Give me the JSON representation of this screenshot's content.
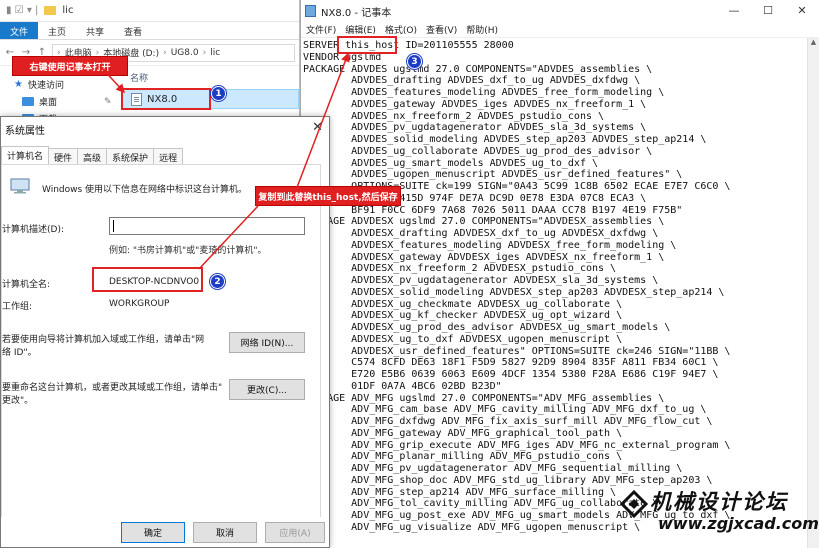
{
  "explorer": {
    "title": "lic",
    "ribbon_tabs": [
      "文件",
      "主页",
      "共享",
      "查看"
    ],
    "breadcrumb": [
      "此电脑",
      "本地磁盘 (D:)",
      "UG8.0",
      "lic"
    ],
    "nav_items": [
      "快速访问",
      "桌面",
      "下载"
    ],
    "column_header": "名称",
    "file_name": "NX8.0"
  },
  "dialog": {
    "title": "系统属性",
    "tabs": [
      "计算机名",
      "硬件",
      "高级",
      "系统保护",
      "远程"
    ],
    "intro": "Windows 使用以下信息在网络中标识这台计算机。",
    "description_label": "计算机描述(D):",
    "description_value": "",
    "example": "例如: \"书房计算机\"或\"麦琦的计算机\"。",
    "fullname_label": "计算机全名:",
    "fullname_value": "DESKTOP-NCDNVO0",
    "workgroup_label": "工作组:",
    "workgroup_value": "WORKGROUP",
    "join_text_1": "若要使用向导将计算机加入域或工作组，请单击\"网",
    "join_text_2": "络 ID\"。",
    "network_id_button": "网络 ID(N)...",
    "rename_text_1": "要重命名这台计算机，或者更改其域或工作组，请单击\"",
    "rename_text_2": "更改\"。",
    "change_button": "更改(C)...",
    "ok_button": "确定",
    "cancel_button": "取消",
    "apply_button": "应用(A)"
  },
  "notepad": {
    "title": "NX8.0 - 记事本",
    "window_controls": [
      "—",
      "☐",
      "✕"
    ],
    "menus": [
      "文件(F)",
      "编辑(E)",
      "格式(O)",
      "查看(V)",
      "帮助(H)"
    ],
    "lines": [
      "SERVER this_host ID=201105555 28000",
      "VENDOR ugslmd",
      "PACKAGE ADVDES ugslmd 27.0 COMPONENTS=\"ADVDES_assemblies \\",
      "        ADVDES_drafting ADVDES_dxf_to_ug ADVDES_dxfdwg \\",
      "        ADVDES_features_modeling ADVDES_free_form_modeling \\",
      "        ADVDES_gateway ADVDES_iges ADVDES_nx_freeform_1 \\",
      "        ADVDES_nx_freeform_2 ADVDES_pstudio_cons \\",
      "        ADVDES_pv_ugdatagenerator ADVDES_sla_3d_systems \\",
      "        ADVDES_solid_modeling ADVDES_step_ap203 ADVDES_step_ap214 \\",
      "        ADVDES_ug_collaborate ADVDES_ug_prod_des_advisor \\",
      "        ADVDES_ug_smart_models ADVDES_ug_to_dxf \\",
      "        ADVDES_ugopen_menuscript ADVDES_usr_defined_features\" \\",
      "        OPTIONS=SUITE ck=199 SIGN=\"0A43 5C99 1C8B 6502 ECAE E7E7 C6C0 \\",
      "        19 84F4 415D 974F DE7A DC9D 0E78 E3DA 07C8 ECA3 \\",
      "        BF91 F0CC 6DF9 7A68 7026 5011 DAAA CC78 B197 4E19 F75B\"",
      "PACKAGE ADVDESX ugslmd 27.0 COMPONENTS=\"ADVDESX_assemblies \\",
      "        ADVDESX_drafting ADVDESX_dxf_to_ug ADVDESX_dxfdwg \\",
      "        ADVDESX_features_modeling ADVDESX_free_form_modeling \\",
      "        ADVDESX_gateway ADVDESX_iges ADVDESX_nx_freeform_1 \\",
      "        ADVDESX_nx_freeform_2 ADVDESX_pstudio_cons \\",
      "        ADVDESX_pv_ugdatagenerator ADVDESX_sla_3d_systems \\",
      "        ADVDESX_solid_modeling ADVDESX_step_ap203 ADVDESX_step_ap214 \\",
      "        ADVDESX_ug_checkmate ADVDESX_ug_collaborate \\",
      "        ADVDESX_ug_kf_checker ADVDESX_ug_opt_wizard \\",
      "        ADVDESX_ug_prod_des_advisor ADVDESX_ug_smart_models \\",
      "        ADVDESX_ug_to_dxf ADVDESX_ugopen_menuscript \\",
      "        ADVDESX_usr_defined_features\" OPTIONS=SUITE ck=246 SIGN=\"11BB \\",
      "        C574 8CFD DE63 18F1 F5D9 5827 92D9 8904 835F A811 FB34 60C1 \\",
      "        E720 E5B6 0639 6063 E609 4DCF 1354 5380 F28A E686 C19F 94E7 \\",
      "        01DF 0A7A 4BC6 02BD B23D\"",
      "PACKAGE ADV_MFG ugslmd 27.0 COMPONENTS=\"ADV_MFG_assemblies \\",
      "        ADV_MFG_cam_base ADV_MFG_cavity_milling ADV_MFG_dxf_to_ug \\",
      "        ADV_MFG_dxfdwg ADV_MFG_fix_axis_surf_mill ADV_MFG_flow_cut \\",
      "        ADV_MFG_gateway ADV_MFG_graphical_tool_path \\",
      "        ADV_MFG_grip_execute ADV_MFG_iges ADV_MFG_nc_external_program \\",
      "        ADV_MFG_planar_milling ADV_MFG_pstudio_cons \\",
      "        ADV_MFG_pv_ugdatagenerator ADV_MFG_sequential_milling \\",
      "        ADV_MFG_shop_doc ADV_MFG_std_ug_library ADV_MFG_step_ap203 \\",
      "        ADV_MFG_step_ap214 ADV_MFG_surface_milling \\",
      "        ADV_MFG_tol_cavity_milling ADV_MFG_ug_collaborate \\",
      "        ADV_MFG_ug_post_exe ADV_MFG_ug_smart_models ADV_MFG_ug_to_dxf \\",
      "        ADV_MFG_ug_visualize ADV_MFG_ugopen_menuscript \\"
    ]
  },
  "annotations": {
    "callout_1": "右键使用记事本打开",
    "callout_2": "复制到此替换this_host,然后保存",
    "badge_1": "1",
    "badge_2": "2",
    "badge_3": "3",
    "accent_color": "#e02020",
    "badge_color": "#1d3ec4"
  },
  "watermark": {
    "title": "机械设计论坛",
    "url": "www.zgjxcad.com"
  }
}
